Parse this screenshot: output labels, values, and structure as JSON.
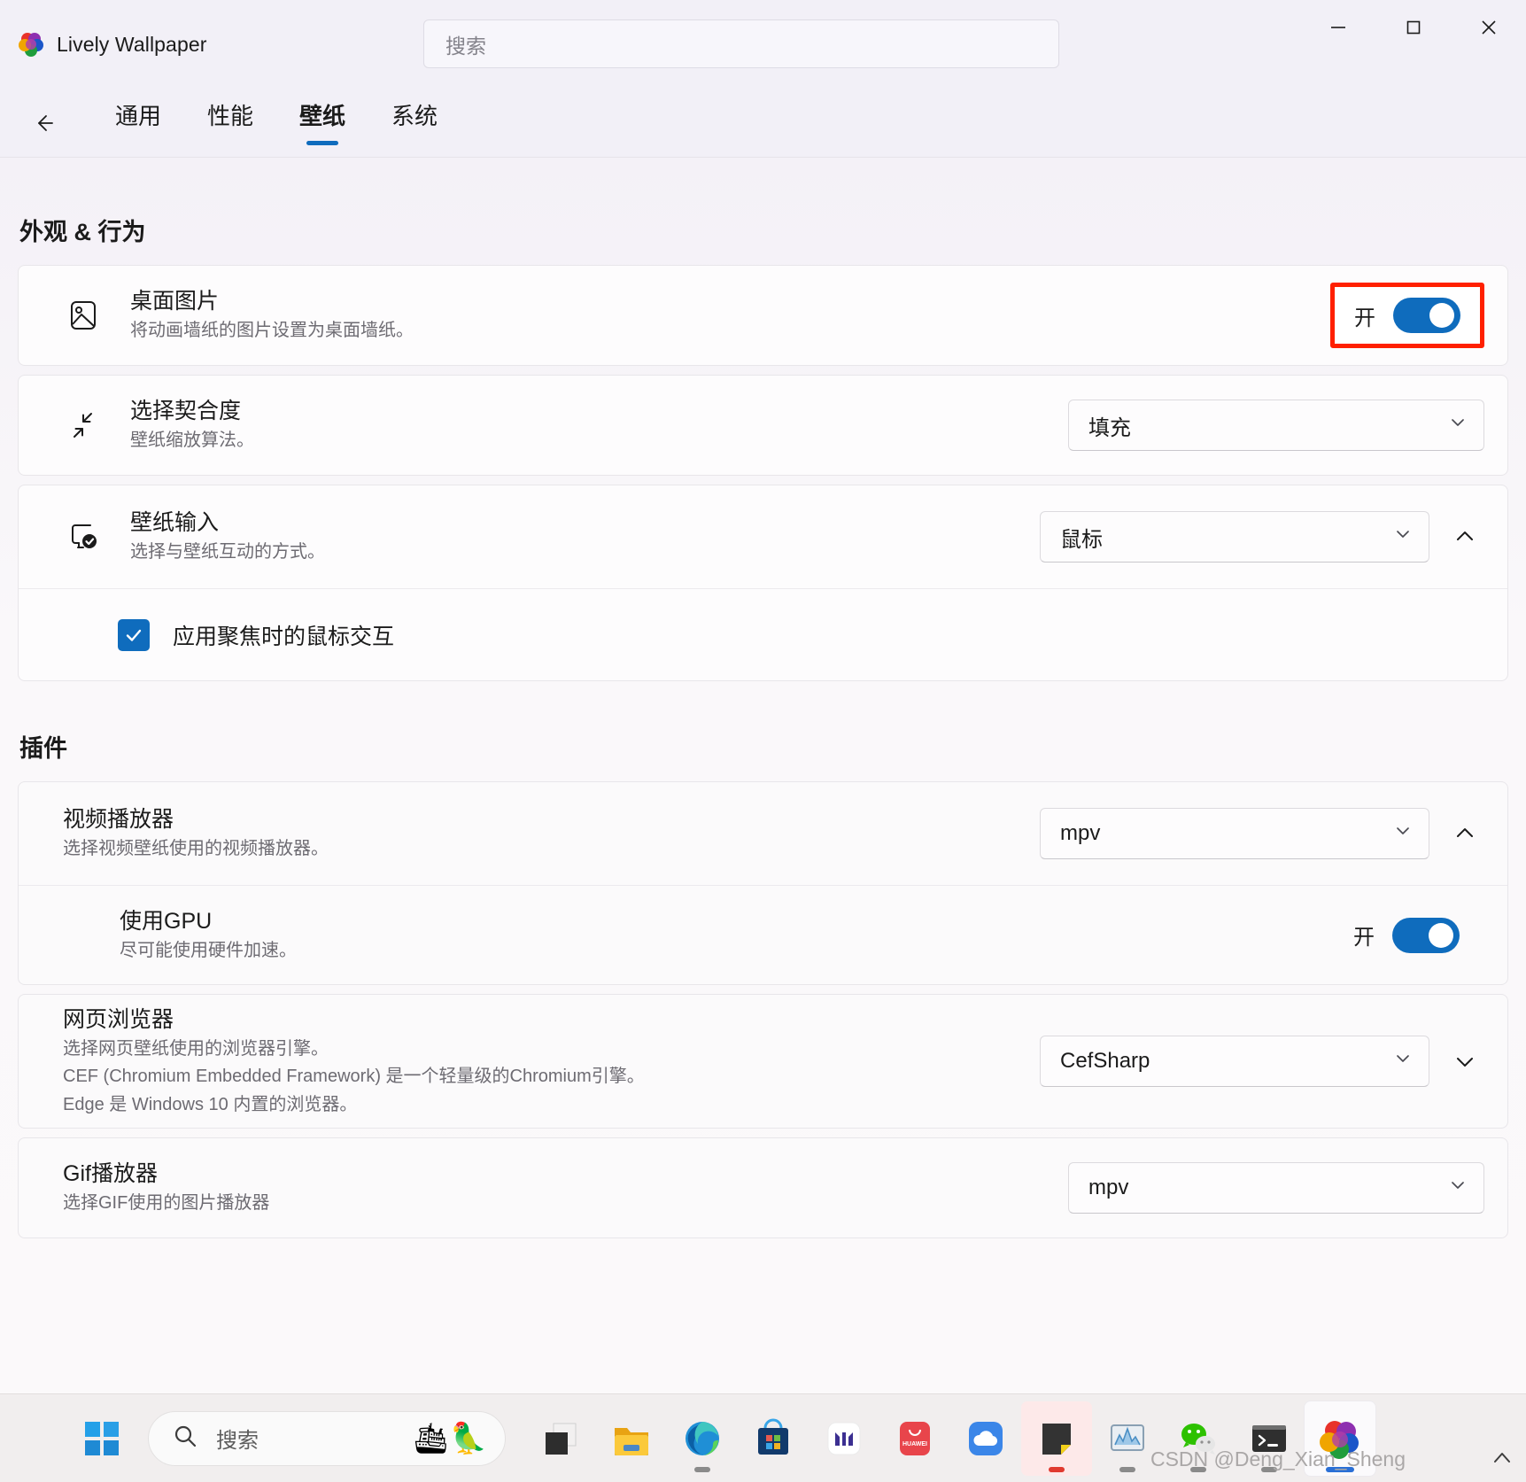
{
  "window": {
    "app_title": "Lively Wallpaper",
    "search_placeholder": "搜索",
    "controls": {
      "minimize": "—",
      "maximize": "□",
      "close": "✕"
    }
  },
  "nav": {
    "back_label": "←",
    "tabs": [
      {
        "label": "通用",
        "active": false
      },
      {
        "label": "性能",
        "active": false
      },
      {
        "label": "壁纸",
        "active": true
      },
      {
        "label": "系统",
        "active": false
      }
    ]
  },
  "sections": [
    {
      "id": "appearance",
      "title": "外观 & 行为"
    },
    {
      "id": "plugins",
      "title": "插件"
    }
  ],
  "appearance": {
    "desktop_image": {
      "title": "桌面图片",
      "subtitle": "将动画墙纸的图片设置为桌面墙纸。",
      "icon": "image-icon",
      "toggle_label": "开",
      "toggle_on": true,
      "highlighted": true
    },
    "fit": {
      "title": "选择契合度",
      "subtitle": "壁纸缩放算法。",
      "icon": "scale-icon",
      "value": "填充"
    },
    "wallpaper_input": {
      "title": "壁纸输入",
      "subtitle": "选择与壁纸互动的方式。",
      "icon": "display-check-icon",
      "value": "鼠标",
      "expanded": true,
      "checkbox": {
        "label": "应用聚焦时的鼠标交互",
        "checked": true
      }
    }
  },
  "plugins": {
    "video_player": {
      "title": "视频播放器",
      "subtitle": "选择视频壁纸使用的视频播放器。",
      "value": "mpv",
      "expanded": true,
      "gpu": {
        "title": "使用GPU",
        "subtitle": "尽可能使用硬件加速。",
        "toggle_label": "开",
        "toggle_on": true
      }
    },
    "web_browser": {
      "title": "网页浏览器",
      "subtitle_1": "选择网页壁纸使用的浏览器引擎。",
      "subtitle_2": "CEF (Chromium Embedded Framework) 是一个轻量级的Chromium引擎。",
      "subtitle_3": "Edge 是 Windows 10 内置的浏览器。",
      "value": "CefSharp",
      "expanded": false
    },
    "gif_player": {
      "title": "Gif播放器",
      "subtitle": "选择GIF使用的图片播放器",
      "value": "mpv"
    }
  },
  "taskbar": {
    "start_label": "start-icon",
    "search_placeholder": "搜索",
    "items": [
      {
        "name": "task-view",
        "running": false
      },
      {
        "name": "file-explorer",
        "running": false
      },
      {
        "name": "microsoft-edge",
        "running": true
      },
      {
        "name": "microsoft-store",
        "running": false
      },
      {
        "name": "mi-app",
        "running": false
      },
      {
        "name": "huawei-app",
        "running": false
      },
      {
        "name": "onedrive-cloud",
        "running": false
      },
      {
        "name": "sticky-notes",
        "running": true,
        "active": true
      },
      {
        "name": "task-manager",
        "running": true
      },
      {
        "name": "wechat",
        "running": true
      },
      {
        "name": "terminal",
        "running": true
      },
      {
        "name": "lively-wallpaper",
        "running": true,
        "active": true
      }
    ],
    "watermark": "CSDN @Deng_Xian_Sheng",
    "overflow_label": "^"
  },
  "colors": {
    "accent": "#0f6cbd",
    "highlight_red": "#ff2000",
    "window_bg": "#f3f2f7",
    "card_bg": "#fdfcfd",
    "text": "#1b1b1b",
    "subtext": "#6d6b72"
  }
}
